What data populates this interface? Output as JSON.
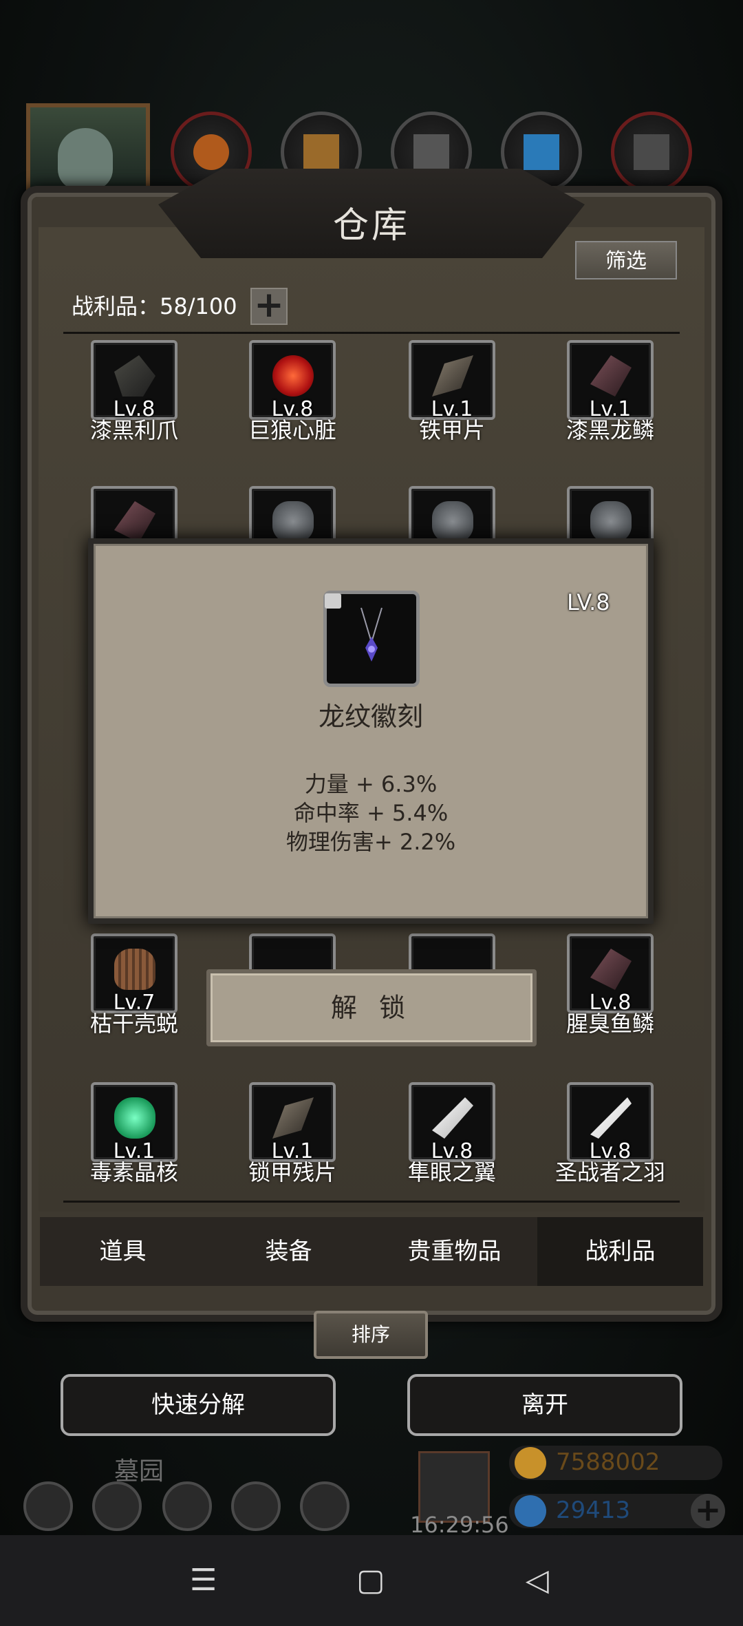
{
  "window": {
    "title": "仓库",
    "filter_label": "筛选"
  },
  "inventory": {
    "count_label": "战利品：",
    "count_value": "58/100",
    "expand_label": "+"
  },
  "items": [
    {
      "name": "漆黑利爪",
      "level": "Lv.8",
      "icon": "claw-icon"
    },
    {
      "name": "巨狼心脏",
      "level": "Lv.8",
      "icon": "heart-icon"
    },
    {
      "name": "铁甲片",
      "level": "Lv.1",
      "icon": "armor-shard-icon"
    },
    {
      "name": "漆黑龙鳞",
      "level": "Lv.1",
      "icon": "scale-icon"
    },
    {
      "name": "枯干壳蜕",
      "level": "Lv.7",
      "icon": "shell-icon"
    },
    {
      "name": "腥臭鱼鳞",
      "level": "Lv.8",
      "icon": "fish-scale-icon"
    },
    {
      "name": "毒素晶核",
      "level": "Lv.1",
      "icon": "crystal-icon"
    },
    {
      "name": "锁甲残片",
      "level": "Lv.1",
      "icon": "chain-shard-icon"
    },
    {
      "name": "隼眼之翼",
      "level": "Lv.8",
      "icon": "wing-icon"
    },
    {
      "name": "圣战者之羽",
      "level": "Lv.8",
      "icon": "feather-icon"
    }
  ],
  "popup": {
    "item_name": "龙纹徽刻",
    "level": "LV.8",
    "icon": "pendant-icon",
    "stats": [
      "力量 + 6.3%",
      "命中率 + 5.4%",
      "物理伤害+ 2.2%"
    ],
    "unlock_label": "解 锁"
  },
  "tabs": [
    {
      "label": "道具",
      "active": false
    },
    {
      "label": "装备",
      "active": false
    },
    {
      "label": "贵重物品",
      "active": false
    },
    {
      "label": "战利品",
      "active": true
    }
  ],
  "actions": {
    "sort_label": "排序",
    "quick_decompose_label": "快速分解",
    "leave_label": "离开"
  },
  "hud": {
    "location_label": "墓园",
    "clock": "16:29:56",
    "gold": "7588002",
    "gems": "29413"
  },
  "colors": {
    "panel": "#3e3930",
    "card": "#a69d8e",
    "gold": "#c8912a",
    "gem": "#2f6fb0"
  }
}
